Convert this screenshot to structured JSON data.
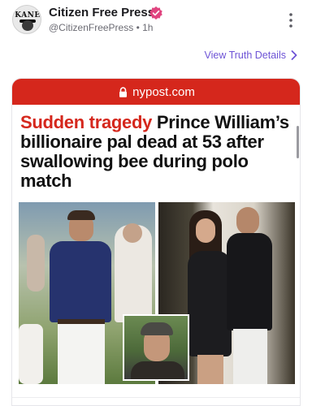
{
  "post": {
    "author_name": "Citizen Free Press",
    "author_handle": "@CitizenFreePress",
    "separator": "•",
    "time_ago": "1h",
    "avatar_text": "KANE",
    "verified_color": "#e0447f",
    "accent_color": "#6e54d6"
  },
  "actions": {
    "view_truth_details": "View Truth Details"
  },
  "card": {
    "source_domain": "nypost.com",
    "source_bar_color": "#d5271c",
    "headline_kicker": "Sudden tragedy",
    "headline_text": "Prince William’s billionaire pal dead at 53 after swallowing bee during polo match"
  },
  "icons": {
    "verified": "verified-badge-icon",
    "more": "more-vertical-icon",
    "chevron": "chevron-right-icon",
    "lock": "lock-icon"
  }
}
